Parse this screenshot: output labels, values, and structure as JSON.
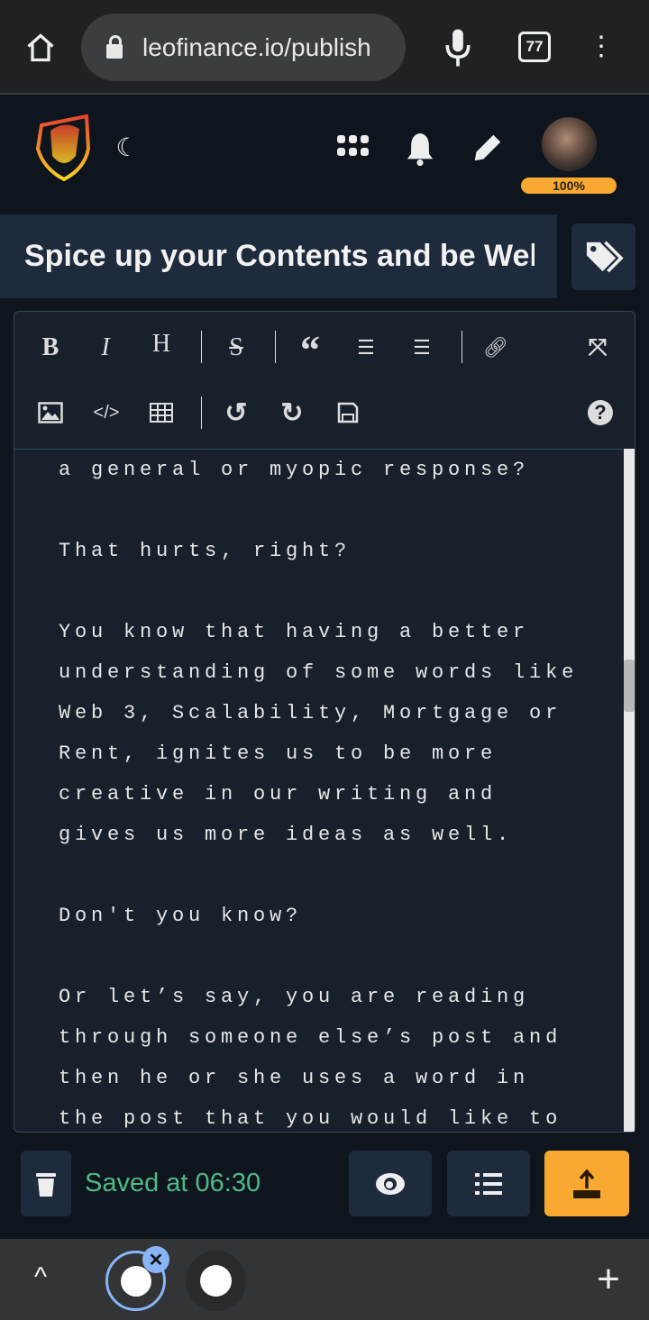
{
  "browser": {
    "url": "leofinance.io/publish",
    "tab_count": "77"
  },
  "header": {
    "mana_percent": "100%",
    "mana_fill": 100
  },
  "post": {
    "title": "Spice up your Contents and be Well Informed"
  },
  "editor": {
    "toolbar_row1": [
      "bold",
      "italic",
      "heading",
      "strikethrough",
      "quote",
      "ordered-list",
      "unordered-list",
      "link",
      "fullscreen"
    ],
    "toolbar_row2": [
      "image",
      "code",
      "table",
      "undo",
      "redo",
      "save",
      "help"
    ],
    "lines": [
      "a general or myopic response?",
      "",
      "That hurts, right?",
      "",
      "You know that having a better",
      "understanding of some words like",
      "Web 3, Scalability, Mortgage or",
      "Rent, ignites us to be more",
      "creative in our writing and",
      "gives us more ideas as well.",
      "",
      "Don't you know?",
      "",
      "Or let’s say, you are reading",
      "through someone else’s post and",
      "then he or she uses a word in",
      "the post that you would like to"
    ]
  },
  "footer": {
    "saved": "Saved at 06:30"
  },
  "colors": {
    "accent": "#f9a832",
    "saved": "#4fb987",
    "panel": "#1e2b3c"
  }
}
